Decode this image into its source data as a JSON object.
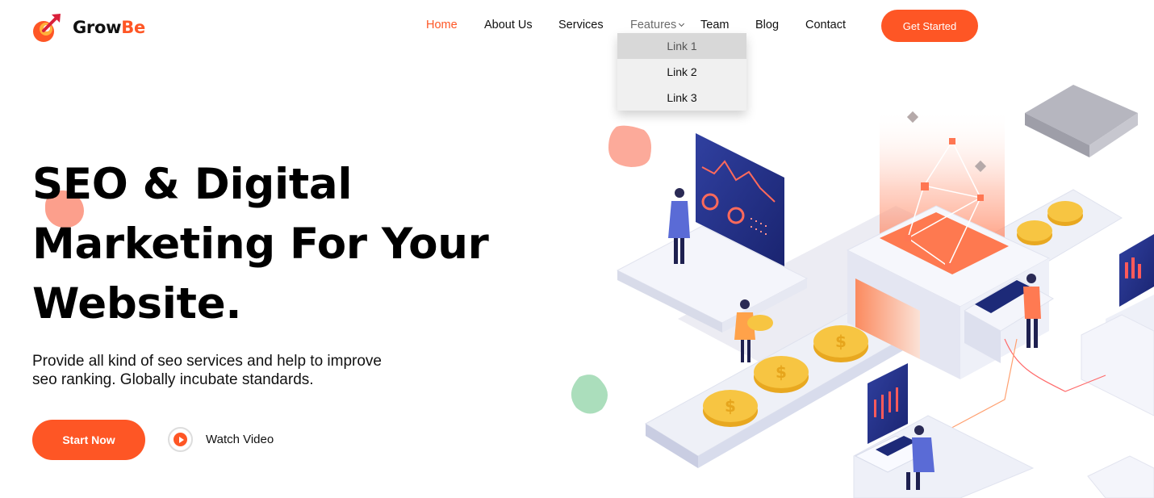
{
  "brand": {
    "name_part1": "Grow",
    "name_part2": "Be",
    "accent_color": "#fe5625"
  },
  "nav": {
    "items": [
      {
        "label": "Home",
        "active": true
      },
      {
        "label": "About Us"
      },
      {
        "label": "Services"
      },
      {
        "label": "Features"
      },
      {
        "label": "Team"
      },
      {
        "label": "Blog"
      },
      {
        "label": "Contact"
      }
    ],
    "cta_label": "Get Started"
  },
  "dropdown": {
    "items": [
      "Link 1",
      "Link 2",
      "Link 3"
    ],
    "highlighted": "Link 1"
  },
  "hero": {
    "title_lines": [
      "SEO & Digital",
      "Marketing For Your",
      "Website."
    ],
    "subtitle_lines": [
      "Provide all kind of seo services and help to improve",
      "seo ranking. Globally incubate standards."
    ],
    "primary_button": "Start Now",
    "video_label": "Watch Video"
  },
  "illustration": {
    "icons": [
      "analytics-dashboard",
      "gold-coin",
      "person",
      "laptop",
      "network-graph"
    ]
  }
}
